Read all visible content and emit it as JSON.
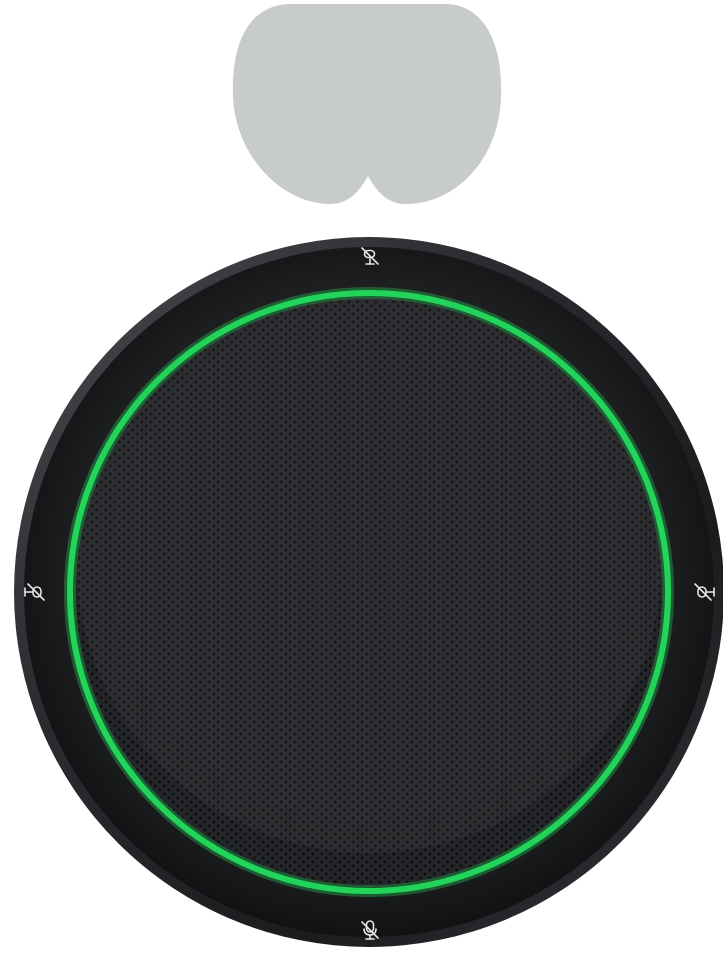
{
  "product": {
    "accessory_shape_color": "#c7cbcb",
    "body_color": "#1b1c1e",
    "rim_highlight_color": "#3a3c40",
    "grille_color": "#232427",
    "led_ring_color": "#22d45a",
    "icon_color": "#e6e6e6"
  },
  "controls": {
    "top_icon": "mute-icon",
    "left_icon": "mute-icon",
    "right_icon": "mute-icon",
    "bottom_icon": "mute-icon"
  }
}
